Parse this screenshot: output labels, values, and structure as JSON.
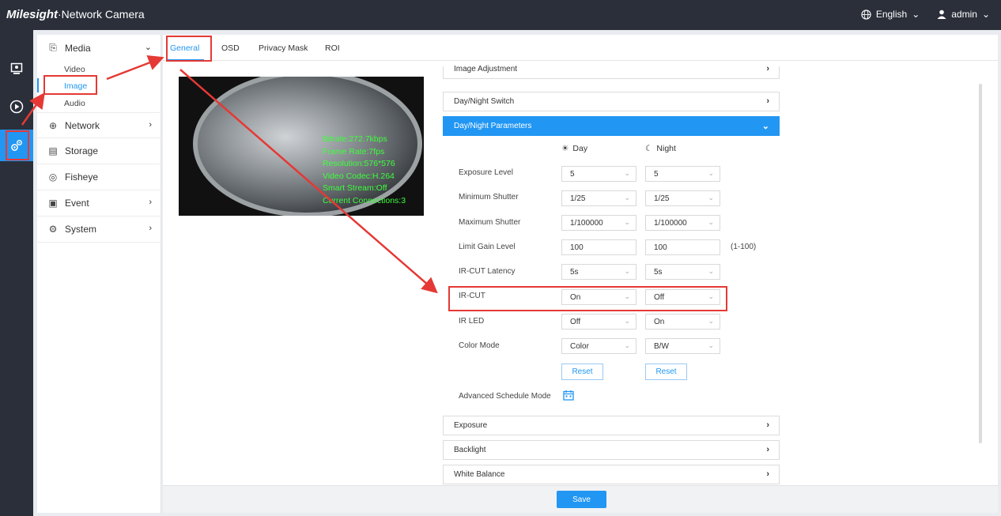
{
  "app": {
    "logo": "Milesight",
    "title": "·Network Camera"
  },
  "topbar": {
    "language": "English",
    "user": "admin"
  },
  "rail": {
    "icons": [
      "live-view-icon",
      "playback-icon",
      "settings-icon"
    ]
  },
  "sidebar": {
    "media": "Media",
    "sub_items": [
      "Video",
      "Image",
      "Audio"
    ],
    "network": "Network",
    "storage": "Storage",
    "fisheye": "Fisheye",
    "event": "Event",
    "system": "System"
  },
  "tabs": [
    "General",
    "OSD",
    "Privacy Mask",
    "ROI"
  ],
  "osd": {
    "bitrate": "Bitrate:272.7kbps",
    "frame_rate": "Frame Rate:7fps",
    "resolution": "Resolution:576*576",
    "codec": "Video Codec:H.264",
    "smart_stream": "Smart Stream:Off",
    "connections": "Current Connections:3"
  },
  "sections": {
    "image_adjustment": "Image Adjustment",
    "day_night_switch": "Day/Night Switch",
    "day_night_params": "Day/Night Parameters",
    "exposure": "Exposure",
    "backlight": "Backlight",
    "white_balance": "White Balance"
  },
  "params": {
    "day_label": "Day",
    "night_label": "Night",
    "exposure_level": {
      "label": "Exposure Level",
      "day": "5",
      "night": "5"
    },
    "min_shutter": {
      "label": "Minimum Shutter",
      "day": "1/25",
      "night": "1/25"
    },
    "max_shutter": {
      "label": "Maximum Shutter",
      "day": "1/100000",
      "night": "1/100000"
    },
    "limit_gain": {
      "label": "Limit Gain Level",
      "day": "100",
      "night": "100",
      "range": "(1-100)"
    },
    "ircut_latency": {
      "label": "IR-CUT Latency",
      "day": "5s",
      "night": "5s"
    },
    "ircut": {
      "label": "IR-CUT",
      "day": "On",
      "night": "Off"
    },
    "ir_led": {
      "label": "IR LED",
      "day": "Off",
      "night": "On"
    },
    "color_mode": {
      "label": "Color Mode",
      "day": "Color",
      "night": "B/W"
    },
    "reset": "Reset",
    "advanced_schedule": "Advanced Schedule Mode"
  },
  "footer": {
    "save": "Save"
  },
  "colors": {
    "accent": "#2196f3",
    "dark": "#2b2f3a",
    "annotation": "#e53935"
  }
}
